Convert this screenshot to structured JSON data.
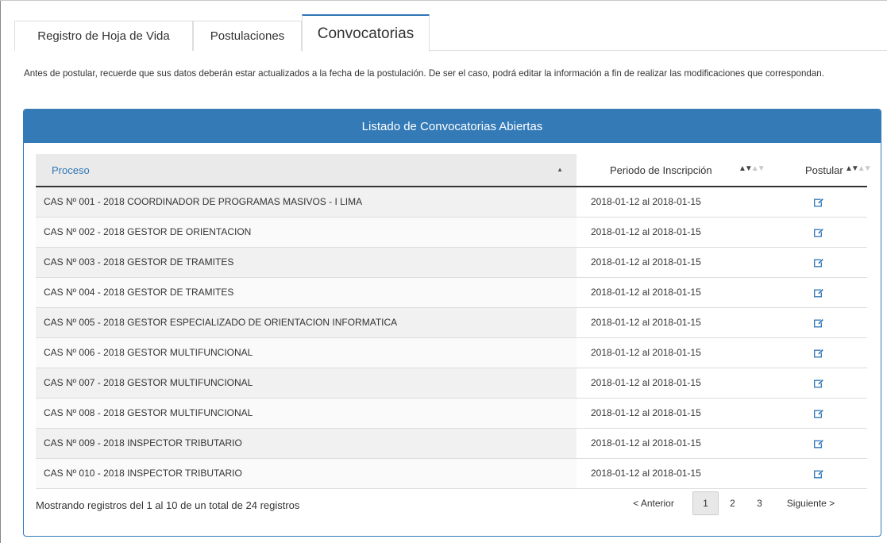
{
  "tabs": [
    {
      "label": "Registro de Hoja de Vida"
    },
    {
      "label": "Postulaciones"
    },
    {
      "label": "Convocatorias"
    }
  ],
  "notice": "Antes de postular, recuerde que sus datos deberán estar actualizados a la fecha de la postulación. De ser el caso, podrá editar la información a fin de realizar las modificaciones que correspondan.",
  "panel": {
    "title": "Listado de Convocatorias Abiertas",
    "columns": {
      "proceso": "Proceso",
      "periodo": "Periodo de Inscripción",
      "postular": "Postular"
    },
    "rows": [
      {
        "proceso": "CAS Nº 001 - 2018 COORDINADOR DE PROGRAMAS MASIVOS - I LIMA",
        "periodo": "2018-01-12 al 2018-01-15",
        "icon": "edit-icon"
      },
      {
        "proceso": "CAS Nº 002 - 2018 GESTOR DE ORIENTACION",
        "periodo": "2018-01-12 al 2018-01-15",
        "icon": "edit-icon"
      },
      {
        "proceso": "CAS Nº 003 - 2018 GESTOR DE TRAMITES",
        "periodo": "2018-01-12 al 2018-01-15",
        "icon": "edit-icon"
      },
      {
        "proceso": "CAS Nº 004 - 2018 GESTOR DE TRAMITES",
        "periodo": "2018-01-12 al 2018-01-15",
        "icon": "edit-icon"
      },
      {
        "proceso": "CAS Nº 005 - 2018 GESTOR ESPECIALIZADO DE ORIENTACION INFORMATICA",
        "periodo": "2018-01-12 al 2018-01-15",
        "icon": "edit-icon"
      },
      {
        "proceso": "CAS Nº 006 - 2018 GESTOR MULTIFUNCIONAL",
        "periodo": "2018-01-12 al 2018-01-15",
        "icon": "edit-icon"
      },
      {
        "proceso": "CAS Nº 007 - 2018 GESTOR MULTIFUNCIONAL",
        "periodo": "2018-01-12 al 2018-01-15",
        "icon": "edit-icon"
      },
      {
        "proceso": "CAS Nº 008 - 2018 GESTOR MULTIFUNCIONAL",
        "periodo": "2018-01-12 al 2018-01-15",
        "icon": "edit-icon"
      },
      {
        "proceso": "CAS Nº 009 - 2018 INSPECTOR TRIBUTARIO",
        "periodo": "2018-01-12 al 2018-01-15",
        "icon": "edit-icon"
      },
      {
        "proceso": "CAS Nº 010 - 2018 INSPECTOR TRIBUTARIO",
        "periodo": "2018-01-12 al 2018-01-15",
        "icon": "edit-icon"
      }
    ],
    "info": "Mostrando registros del 1 al 10 de un total de 24 registros",
    "pagination": {
      "prev": "< Anterior",
      "pages": [
        "1",
        "2",
        "3"
      ],
      "next": "Siguiente >"
    }
  },
  "colors": {
    "primary": "#337ab7",
    "link": "#2e75b6",
    "icon": "#2e75b6"
  }
}
